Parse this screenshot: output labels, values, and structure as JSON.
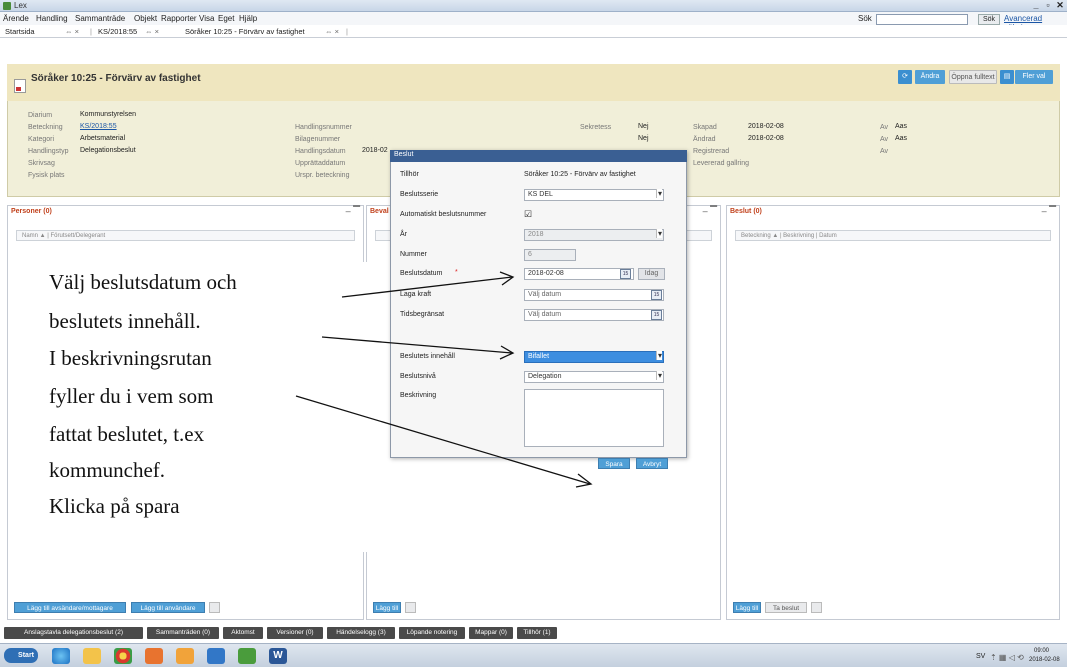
{
  "window": {
    "title": "Lex",
    "controls": [
      "_",
      "▫",
      "✕"
    ]
  },
  "menu": {
    "items": [
      "Ärende",
      "Handling",
      "Sammanträde",
      "Objekt",
      "Rapporter",
      "Visa",
      "Eget",
      "Hjälp"
    ],
    "search_label": "Sök",
    "search_button": "Sök",
    "advanced_search": "Avancerad sökning"
  },
  "tabs": {
    "start": "Startsida",
    "t1": "⇔ ×",
    "case": "KS/2018:55",
    "t2": "⇔ ×",
    "doc": "Söråker 10:25 - Förvärv av fastighet",
    "t3": "⇔ ×"
  },
  "header": {
    "title": "Söråker 10:25 - Förvärv av fastighet",
    "buttons": {
      "change": "Ändra",
      "open_fulltext": "Öppna fulltext",
      "more": "Fler val"
    },
    "fields": {
      "diarium_l": "Diarium",
      "diarium_v": "Kommunstyrelsen",
      "beteckning_l": "Beteckning",
      "beteckning_v": "KS/2018:55",
      "kategori_l": "Kategori",
      "kategori_v": "Arbetsmaterial",
      "handlingstyp_l": "Handlingstyp",
      "handlingstyp_v": "Delegationsbeslut",
      "skrivsag_l": "Skrivsag",
      "fysisk_l": "Fysisk plats",
      "handlingsnummer_l": "Handlingsnummer",
      "bilagenummer_l": "Bilagenummer",
      "handlingsdatum_l": "Handlingsdatum",
      "handlingsdatum_v": "2018-02",
      "upprattad_l": "Upprättaddatum",
      "urspr_l": "Urspr. beteckning",
      "sekretess_l": "Sekretess",
      "sekretess_v": "Nej",
      "nej2": "Nej",
      "skapad_l": "Skapad",
      "skapad_v": "2018-02-08",
      "andrad_l": "Ändrad",
      "andrad_v": "2018-02-08",
      "registrerad_l": "Registrerad",
      "levererad_l": "Levererad gallring",
      "av1_l": "Av",
      "av1_v": "Aas",
      "av2_l": "Av",
      "av2_v": "Aas",
      "av3_l": "Av"
    }
  },
  "panels": {
    "personer": {
      "title": "Personer (0)",
      "cols": "Namn ▲  |  Förutsett/Delegerant",
      "btn1": "Lägg till avsändare/mottagare",
      "btn2": "Lägg till användare"
    },
    "bevak": {
      "title": "Beval",
      "btn1": "Lägg till"
    },
    "beslut": {
      "title": "Beslut (0)",
      "cols": "Beteckning ▲  |  Beskrivning  |  Datum",
      "btn1": "Lägg till",
      "btn2": "Ta beslut"
    }
  },
  "bottom_tabs": [
    "Anslagstavla delegationsbeslut (2)",
    "Sammanträden (0)",
    "Aktomst",
    "Versioner (0)",
    "Händelselogg (3)",
    "Löpande notering",
    "Mappar (0)",
    "Tillhör (1)"
  ],
  "dialog": {
    "title": "Beslut",
    "tillhor_l": "Tillhör",
    "tillhor_v": "Söråker 10:25 - Förvärv av fastighet",
    "beslutsserie_l": "Beslutsserie",
    "beslutsserie_v": "KS DEL",
    "auto_l": "Automatiskt beslutsnummer",
    "auto_v": "☑",
    "ar_l": "År",
    "ar_v": "2018",
    "nummer_l": "Nummer",
    "nummer_v": "6",
    "beslutsdatum_l": "Beslutsdatum",
    "required": "*",
    "beslutsdatum_v": "2018-02-08",
    "idag": "Idag",
    "laga_l": "Laga kraft",
    "laga_v": "Välj datum",
    "tidsbeg_l": "Tidsbegränsat",
    "tidsbeg_v": "Välj datum",
    "innehall_l": "Beslutets innehåll",
    "innehall_v": "Bifallet",
    "niva_l": "Beslutsnivå",
    "niva_v": "Delegation",
    "beskrivning_l": "Beskrivning",
    "save": "Spara",
    "cancel": "Avbryt",
    "cal_text": "15"
  },
  "annotation": {
    "lines": [
      "Välj beslutsdatum och",
      "beslutets innehåll.",
      "I beskrivningsrutan",
      "fyller du i vem som",
      "fattat beslutet, t.ex",
      "kommunchef.",
      "Klicka på spara"
    ]
  },
  "taskbar": {
    "start": "Start",
    "lang": "SV",
    "time": "09:00",
    "date": "2018-02-08"
  },
  "colors": {
    "accent": "#4f9fd6",
    "dialog_title": "#3a5f93",
    "header_bg": "#f1efd9",
    "panel_title": "#c1411c",
    "selected": "#3d8ee0"
  }
}
